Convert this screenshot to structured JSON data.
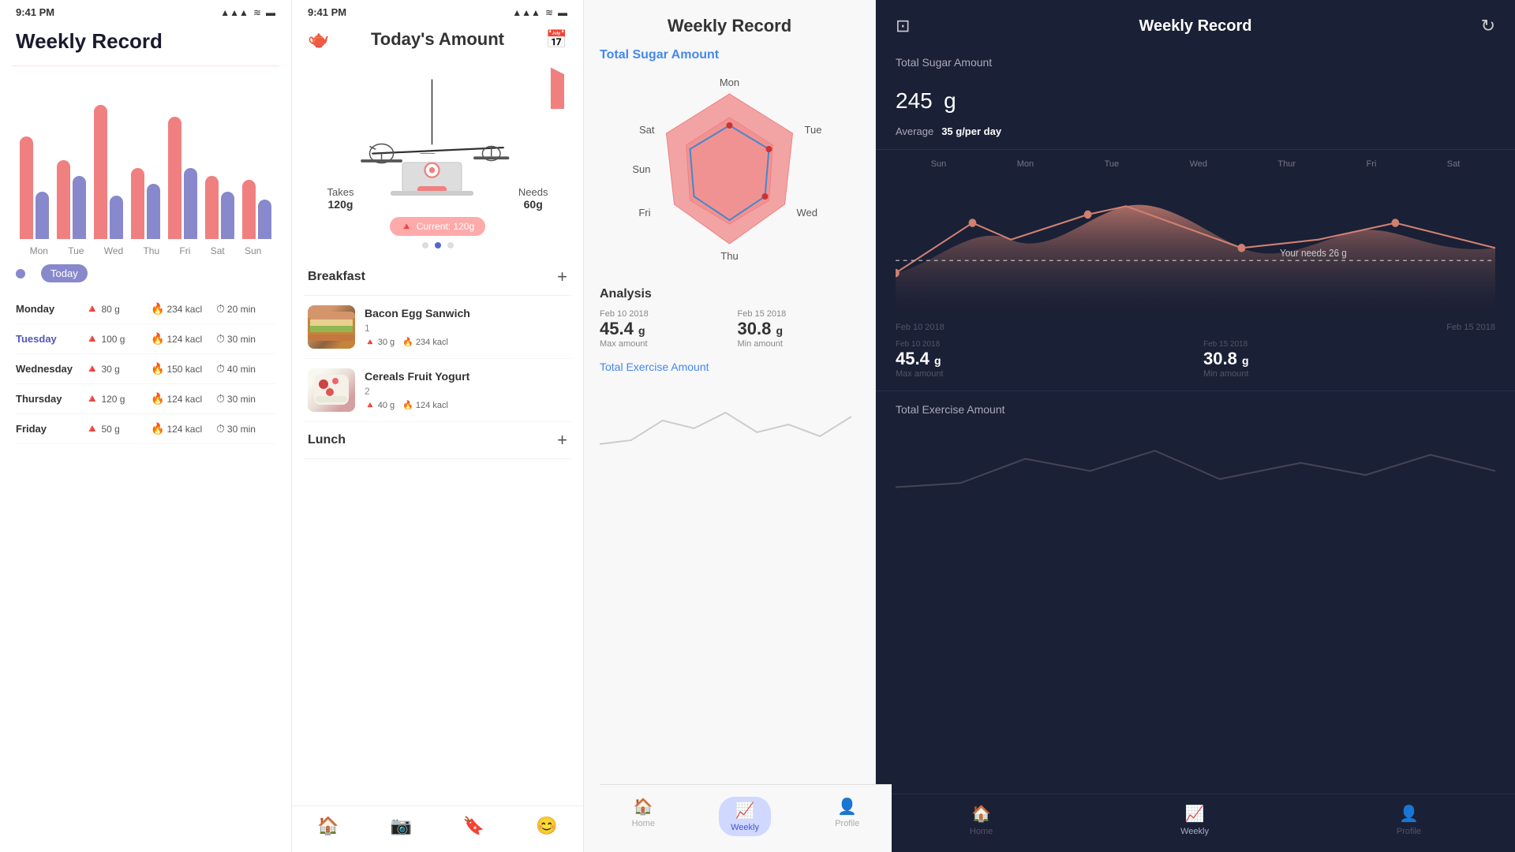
{
  "panel1": {
    "status": {
      "time": "9:41\nPM",
      "signal": "▲▲▲",
      "wifi": "wifi",
      "battery": "🔋"
    },
    "title": "Weekly Record",
    "bars": [
      {
        "day": "Mon",
        "salmon": 130,
        "purple": 60
      },
      {
        "day": "Tue",
        "salmon": 100,
        "purple": 80
      },
      {
        "day": "Wed",
        "salmon": 170,
        "purple": 55
      },
      {
        "day": "Thu",
        "salmon": 90,
        "purple": 70
      },
      {
        "day": "Fri",
        "salmon": 155,
        "purple": 90
      },
      {
        "day": "Sat",
        "salmon": 80,
        "purple": 60
      },
      {
        "day": "Sun",
        "salmon": 75,
        "purple": 50
      }
    ],
    "legend_today": "Today",
    "rows": [
      {
        "day": "Monday",
        "active": false,
        "sugar": "80 g",
        "kcal": "234 kacl",
        "min": "20 min"
      },
      {
        "day": "Tuesday",
        "active": true,
        "sugar": "100 g",
        "kcal": "124 kacl",
        "min": "30 min"
      },
      {
        "day": "Wednesday",
        "active": false,
        "sugar": "30 g",
        "kcal": "150 kacl",
        "min": "40 min"
      },
      {
        "day": "Thursday",
        "active": false,
        "sugar": "120 g",
        "kcal": "124 kacl",
        "min": "30 min"
      },
      {
        "day": "Friday",
        "active": false,
        "sugar": "50 g",
        "kcal": "124 kacl",
        "min": "30 min"
      }
    ]
  },
  "panel2": {
    "status": {
      "time": "9:41\nPM"
    },
    "title": "Today's Amount",
    "scale": {
      "takes_label": "Takes",
      "takes_val": "120g",
      "needs_label": "Needs",
      "needs_val": "60g",
      "current_label": "Current: 120g"
    },
    "dots": [
      0,
      1,
      2
    ],
    "active_dot": 1,
    "breakfast_label": "Breakfast",
    "lunch_label": "Lunch",
    "items": [
      {
        "name": "Bacon Egg Sanwich",
        "num": "1",
        "sugar": "30 g",
        "kcal": "234 kacl",
        "type": "sandwich"
      },
      {
        "name": "Cereals Fruit Yogurt",
        "num": "2",
        "sugar": "40 g",
        "kcal": "124 kacl",
        "type": "yogurt"
      }
    ],
    "nav": [
      {
        "icon": "🏠",
        "label": "Home",
        "active": true
      },
      {
        "icon": "📷",
        "label": "",
        "active": false
      },
      {
        "icon": "🔖",
        "label": "",
        "active": false
      },
      {
        "icon": "😊",
        "label": "",
        "active": false
      }
    ]
  },
  "panel3": {
    "title": "Weekly Record",
    "sugar_label": "Total Sugar Amount",
    "radar_days": [
      "Mon",
      "Tue",
      "Wed",
      "Thu",
      "Fri",
      "Sat",
      "Sun"
    ],
    "analysis_label": "Analysis",
    "analysis": [
      {
        "date": "Feb 10 2018",
        "val": "45.4",
        "unit": "g",
        "desc": "Max amount"
      },
      {
        "date": "Feb 15 2018",
        "val": "30.8",
        "unit": "g",
        "desc": "Min amount"
      }
    ],
    "exercise_label": "Total Exercise Amount",
    "nav": [
      {
        "icon": "🏠",
        "label": "Home",
        "active": false
      },
      {
        "icon": "📈",
        "label": "Weekly",
        "active": true
      },
      {
        "icon": "👤",
        "label": "Profile",
        "active": false
      }
    ]
  },
  "panel4": {
    "title": "Weekly Record",
    "sugar_section": {
      "label": "Total Sugar Amount",
      "value": "245",
      "unit": "g"
    },
    "average_label": "Average",
    "average_val": "35 g/per day",
    "week_days": [
      "Sun",
      "Mon",
      "Tue",
      "Wed",
      "Thur",
      "Fri",
      "Sat"
    ],
    "needs_line": "Your needs 26 g",
    "dates": [
      "Feb 10 2018",
      "Feb 15 2018"
    ],
    "analysis": [
      {
        "val": "45.4",
        "unit": "g",
        "desc": "Max amount"
      },
      {
        "val": "30.8",
        "unit": "g",
        "desc": "Min amount"
      }
    ],
    "exercise_label": "Total Exercise Amount",
    "nav": [
      {
        "icon": "🏠",
        "label": "Home",
        "active": false
      },
      {
        "icon": "📈",
        "label": "Weekly",
        "active": true
      },
      {
        "icon": "👤",
        "label": "Profile",
        "active": false
      }
    ]
  }
}
